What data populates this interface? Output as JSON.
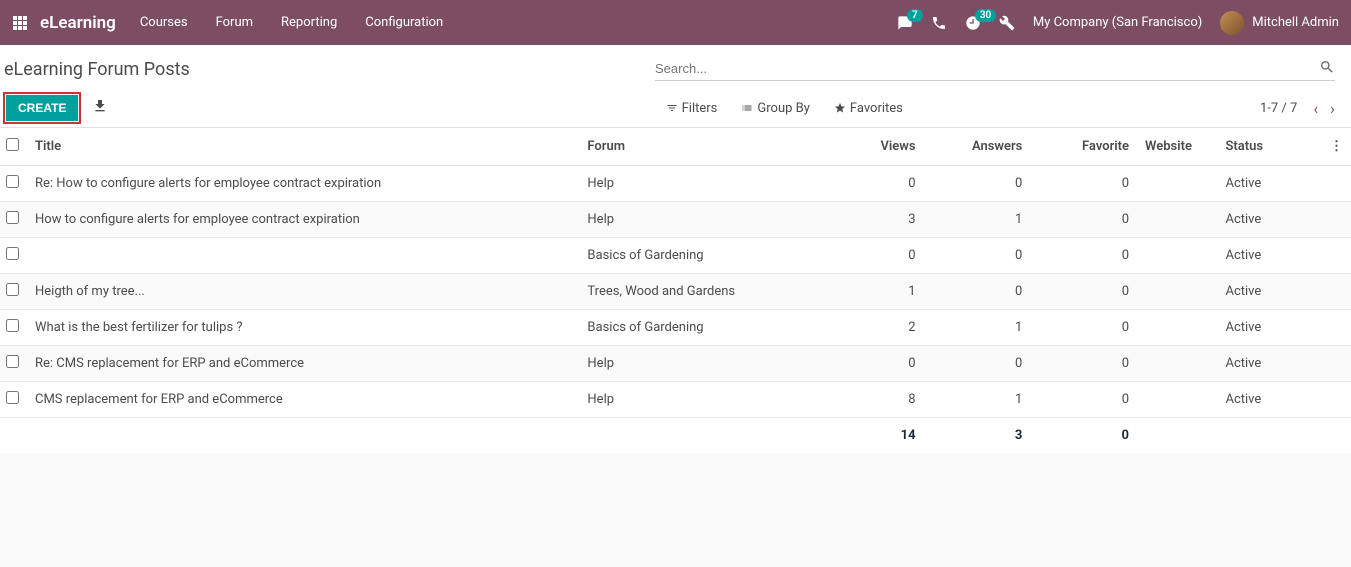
{
  "navbar": {
    "brand": "eLearning",
    "links": [
      "Courses",
      "Forum",
      "Reporting",
      "Configuration"
    ],
    "badge_chat": "7",
    "badge_clock": "30",
    "company": "My Company (San Francisco)",
    "user_name": "Mitchell Admin"
  },
  "breadcrumb": "eLearning Forum Posts",
  "search": {
    "placeholder": "Search..."
  },
  "buttons": {
    "create": "CREATE"
  },
  "filters": {
    "filters": "Filters",
    "group_by": "Group By",
    "favorites": "Favorites"
  },
  "pager": {
    "range": "1-7 / 7"
  },
  "columns": {
    "title": "Title",
    "forum": "Forum",
    "views": "Views",
    "answers": "Answers",
    "favorite": "Favorite",
    "website": "Website",
    "status": "Status"
  },
  "rows": [
    {
      "title": "Re: How to configure alerts for employee contract expiration",
      "forum": "Help",
      "views": "0",
      "answers": "0",
      "favorite": "0",
      "status": "Active"
    },
    {
      "title": "How to configure alerts for employee contract expiration",
      "forum": "Help",
      "views": "3",
      "answers": "1",
      "favorite": "0",
      "status": "Active"
    },
    {
      "title": "",
      "forum": "Basics of Gardening",
      "views": "0",
      "answers": "0",
      "favorite": "0",
      "status": "Active"
    },
    {
      "title": "Heigth of my tree...",
      "forum": "Trees, Wood and Gardens",
      "views": "1",
      "answers": "0",
      "favorite": "0",
      "status": "Active"
    },
    {
      "title": "What is the best fertilizer for tulips ?",
      "forum": "Basics of Gardening",
      "views": "2",
      "answers": "1",
      "favorite": "0",
      "status": "Active"
    },
    {
      "title": "Re: CMS replacement for ERP and eCommerce",
      "forum": "Help",
      "views": "0",
      "answers": "0",
      "favorite": "0",
      "status": "Active"
    },
    {
      "title": "CMS replacement for ERP and eCommerce",
      "forum": "Help",
      "views": "8",
      "answers": "1",
      "favorite": "0",
      "status": "Active"
    }
  ],
  "totals": {
    "views": "14",
    "answers": "3",
    "favorite": "0"
  }
}
